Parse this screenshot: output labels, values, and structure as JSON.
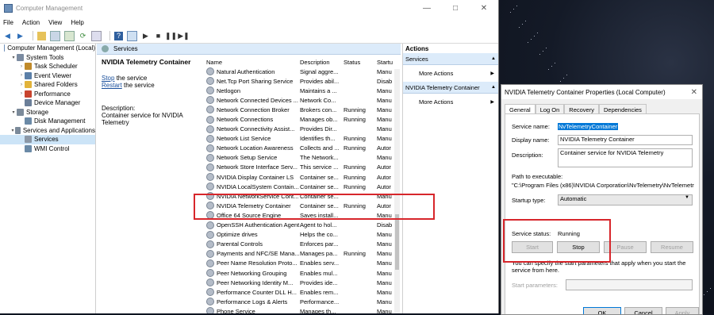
{
  "window": {
    "title": "Computer Management",
    "controls": {
      "minimize": "—",
      "maximize": "□",
      "close": "✕"
    }
  },
  "menu": [
    "File",
    "Action",
    "View",
    "Help"
  ],
  "toolbar_icons": [
    "back-icon",
    "forward-icon",
    "folder-up-icon",
    "show-hide-tree-icon",
    "refresh-icon",
    "export-icon",
    "help-icon",
    "properties-icon",
    "play-icon",
    "stop-icon",
    "pause-icon",
    "resume-icon"
  ],
  "tree": [
    {
      "label": "Computer Management (Local)",
      "level": 0,
      "expander": "",
      "icon": "computer-icon",
      "color": "#6f8fb8"
    },
    {
      "label": "System Tools",
      "level": 1,
      "expander": "▾",
      "icon": "tools-icon",
      "color": "#7a8aa0"
    },
    {
      "label": "Task Scheduler",
      "level": 2,
      "expander": "›",
      "icon": "clock-icon",
      "color": "#c08a2a"
    },
    {
      "label": "Event Viewer",
      "level": 2,
      "expander": "›",
      "icon": "event-viewer-icon",
      "color": "#5b7fa8"
    },
    {
      "label": "Shared Folders",
      "level": 2,
      "expander": "›",
      "icon": "shared-folder-icon",
      "color": "#e2b33a"
    },
    {
      "label": "Performance",
      "level": 2,
      "expander": "›",
      "icon": "performance-icon",
      "color": "#c8442e"
    },
    {
      "label": "Device Manager",
      "level": 2,
      "expander": "",
      "icon": "device-manager-icon",
      "color": "#6b7f99"
    },
    {
      "label": "Storage",
      "level": 1,
      "expander": "▾",
      "icon": "storage-icon",
      "color": "#7b8a9a"
    },
    {
      "label": "Disk Management",
      "level": 2,
      "expander": "",
      "icon": "disk-icon",
      "color": "#6b8aa7"
    },
    {
      "label": "Services and Applications",
      "level": 1,
      "expander": "▾",
      "icon": "services-apps-icon",
      "color": "#7b8a9a"
    },
    {
      "label": "Services",
      "level": 2,
      "expander": "",
      "icon": "services-icon",
      "color": "#8b97a6",
      "selected": true
    },
    {
      "label": "WMI Control",
      "level": 2,
      "expander": "",
      "icon": "wmi-icon",
      "color": "#6b8aa7"
    }
  ],
  "middle": {
    "header": "Services",
    "selected_service": "NVIDIA Telemetry Container",
    "stop_link": "Stop",
    "stop_suffix": " the service",
    "restart_link": "Restart",
    "restart_suffix": " the service",
    "description_label": "Description:",
    "description_text": "Container service for NVIDIA Telemetry"
  },
  "columns": [
    "Name",
    "Description",
    "Status",
    "Startu"
  ],
  "services": [
    {
      "name": "Natural Authentication",
      "desc": "Signal aggre...",
      "status": "",
      "startup": "Manu"
    },
    {
      "name": "Net.Tcp Port Sharing Service",
      "desc": "Provides abil...",
      "status": "",
      "startup": "Disab"
    },
    {
      "name": "Netlogon",
      "desc": "Maintains a ...",
      "status": "",
      "startup": "Manu"
    },
    {
      "name": "Network Connected Devices ...",
      "desc": "Network Co...",
      "status": "",
      "startup": "Manu"
    },
    {
      "name": "Network Connection Broker",
      "desc": "Brokers con...",
      "status": "Running",
      "startup": "Manu"
    },
    {
      "name": "Network Connections",
      "desc": "Manages ob...",
      "status": "Running",
      "startup": "Manu"
    },
    {
      "name": "Network Connectivity Assist...",
      "desc": "Provides Dir...",
      "status": "",
      "startup": "Manu"
    },
    {
      "name": "Network List Service",
      "desc": "Identifies th...",
      "status": "Running",
      "startup": "Manu"
    },
    {
      "name": "Network Location Awareness",
      "desc": "Collects and ...",
      "status": "Running",
      "startup": "Autor"
    },
    {
      "name": "Network Setup Service",
      "desc": "The Network...",
      "status": "",
      "startup": "Manu"
    },
    {
      "name": "Network Store Interface Serv...",
      "desc": "This service ...",
      "status": "Running",
      "startup": "Autor"
    },
    {
      "name": "NVIDIA Display Container LS",
      "desc": "Container se...",
      "status": "Running",
      "startup": "Autor"
    },
    {
      "name": "NVIDIA LocalSystem Contain...",
      "desc": "Container se...",
      "status": "Running",
      "startup": "Autor"
    },
    {
      "name": "NVIDIA NetworkService Cont...",
      "desc": "Container se...",
      "status": "",
      "startup": "Manu"
    },
    {
      "name": "NVIDIA Telemetry Container",
      "desc": "Container se...",
      "status": "Running",
      "startup": "Autor"
    },
    {
      "name": "Office 64 Source Engine",
      "desc": "Saves install...",
      "status": "",
      "startup": "Manu"
    },
    {
      "name": "OpenSSH Authentication Agent",
      "desc": "Agent to hol...",
      "status": "",
      "startup": "Disab"
    },
    {
      "name": "Optimize drives",
      "desc": "Helps the co...",
      "status": "",
      "startup": "Manu"
    },
    {
      "name": "Parental Controls",
      "desc": "Enforces par...",
      "status": "",
      "startup": "Manu"
    },
    {
      "name": "Payments and NFC/SE Mana...",
      "desc": "Manages pa...",
      "status": "Running",
      "startup": "Manu"
    },
    {
      "name": "Peer Name Resolution Proto...",
      "desc": "Enables serv...",
      "status": "",
      "startup": "Manu"
    },
    {
      "name": "Peer Networking Grouping",
      "desc": "Enables mul...",
      "status": "",
      "startup": "Manu"
    },
    {
      "name": "Peer Networking Identity M...",
      "desc": "Provides ide...",
      "status": "",
      "startup": "Manu"
    },
    {
      "name": "Performance Counter DLL H...",
      "desc": "Enables rem...",
      "status": "",
      "startup": "Manu"
    },
    {
      "name": "Performance Logs & Alerts",
      "desc": "Performance...",
      "status": "",
      "startup": "Manu"
    },
    {
      "name": "Phone Service",
      "desc": "Manages th...",
      "status": "",
      "startup": "Manu"
    }
  ],
  "actions": {
    "header": "Actions",
    "sections": [
      {
        "title": "Services",
        "item": "More Actions"
      },
      {
        "title": "NVIDIA Telemetry Container",
        "item": "More Actions"
      }
    ]
  },
  "dialog": {
    "title": "NVIDIA Telemetry Container Properties (Local Computer)",
    "tabs": [
      "General",
      "Log On",
      "Recovery",
      "Dependencies"
    ],
    "service_name_label": "Service name:",
    "service_name": "NvTelemetryContainer",
    "display_name_label": "Display name:",
    "display_name": "NVIDIA Telemetry Container",
    "description_label": "Description:",
    "description": "Container service for NVIDIA Telemetry",
    "path_label": "Path to executable:",
    "path": "\"C:\\Program Files (x86)\\NVIDIA Corporation\\NvTelemetry\\NvTelemetryConta",
    "startup_label": "Startup type:",
    "startup_value": "Automatic",
    "status_label": "Service status:",
    "status_value": "Running",
    "buttons": {
      "start": "Start",
      "stop": "Stop",
      "pause": "Pause",
      "resume": "Resume"
    },
    "hint": "You can specify the start parameters that apply when you start the service from here.",
    "params_label": "Start parameters:",
    "ok": "OK",
    "cancel": "Cancel",
    "apply": "Apply"
  },
  "colors": {
    "selection": "#cce4f7",
    "highlight_box": "#d7262b",
    "link": "#1a4f9c",
    "header_blue": "#dcebfa"
  }
}
